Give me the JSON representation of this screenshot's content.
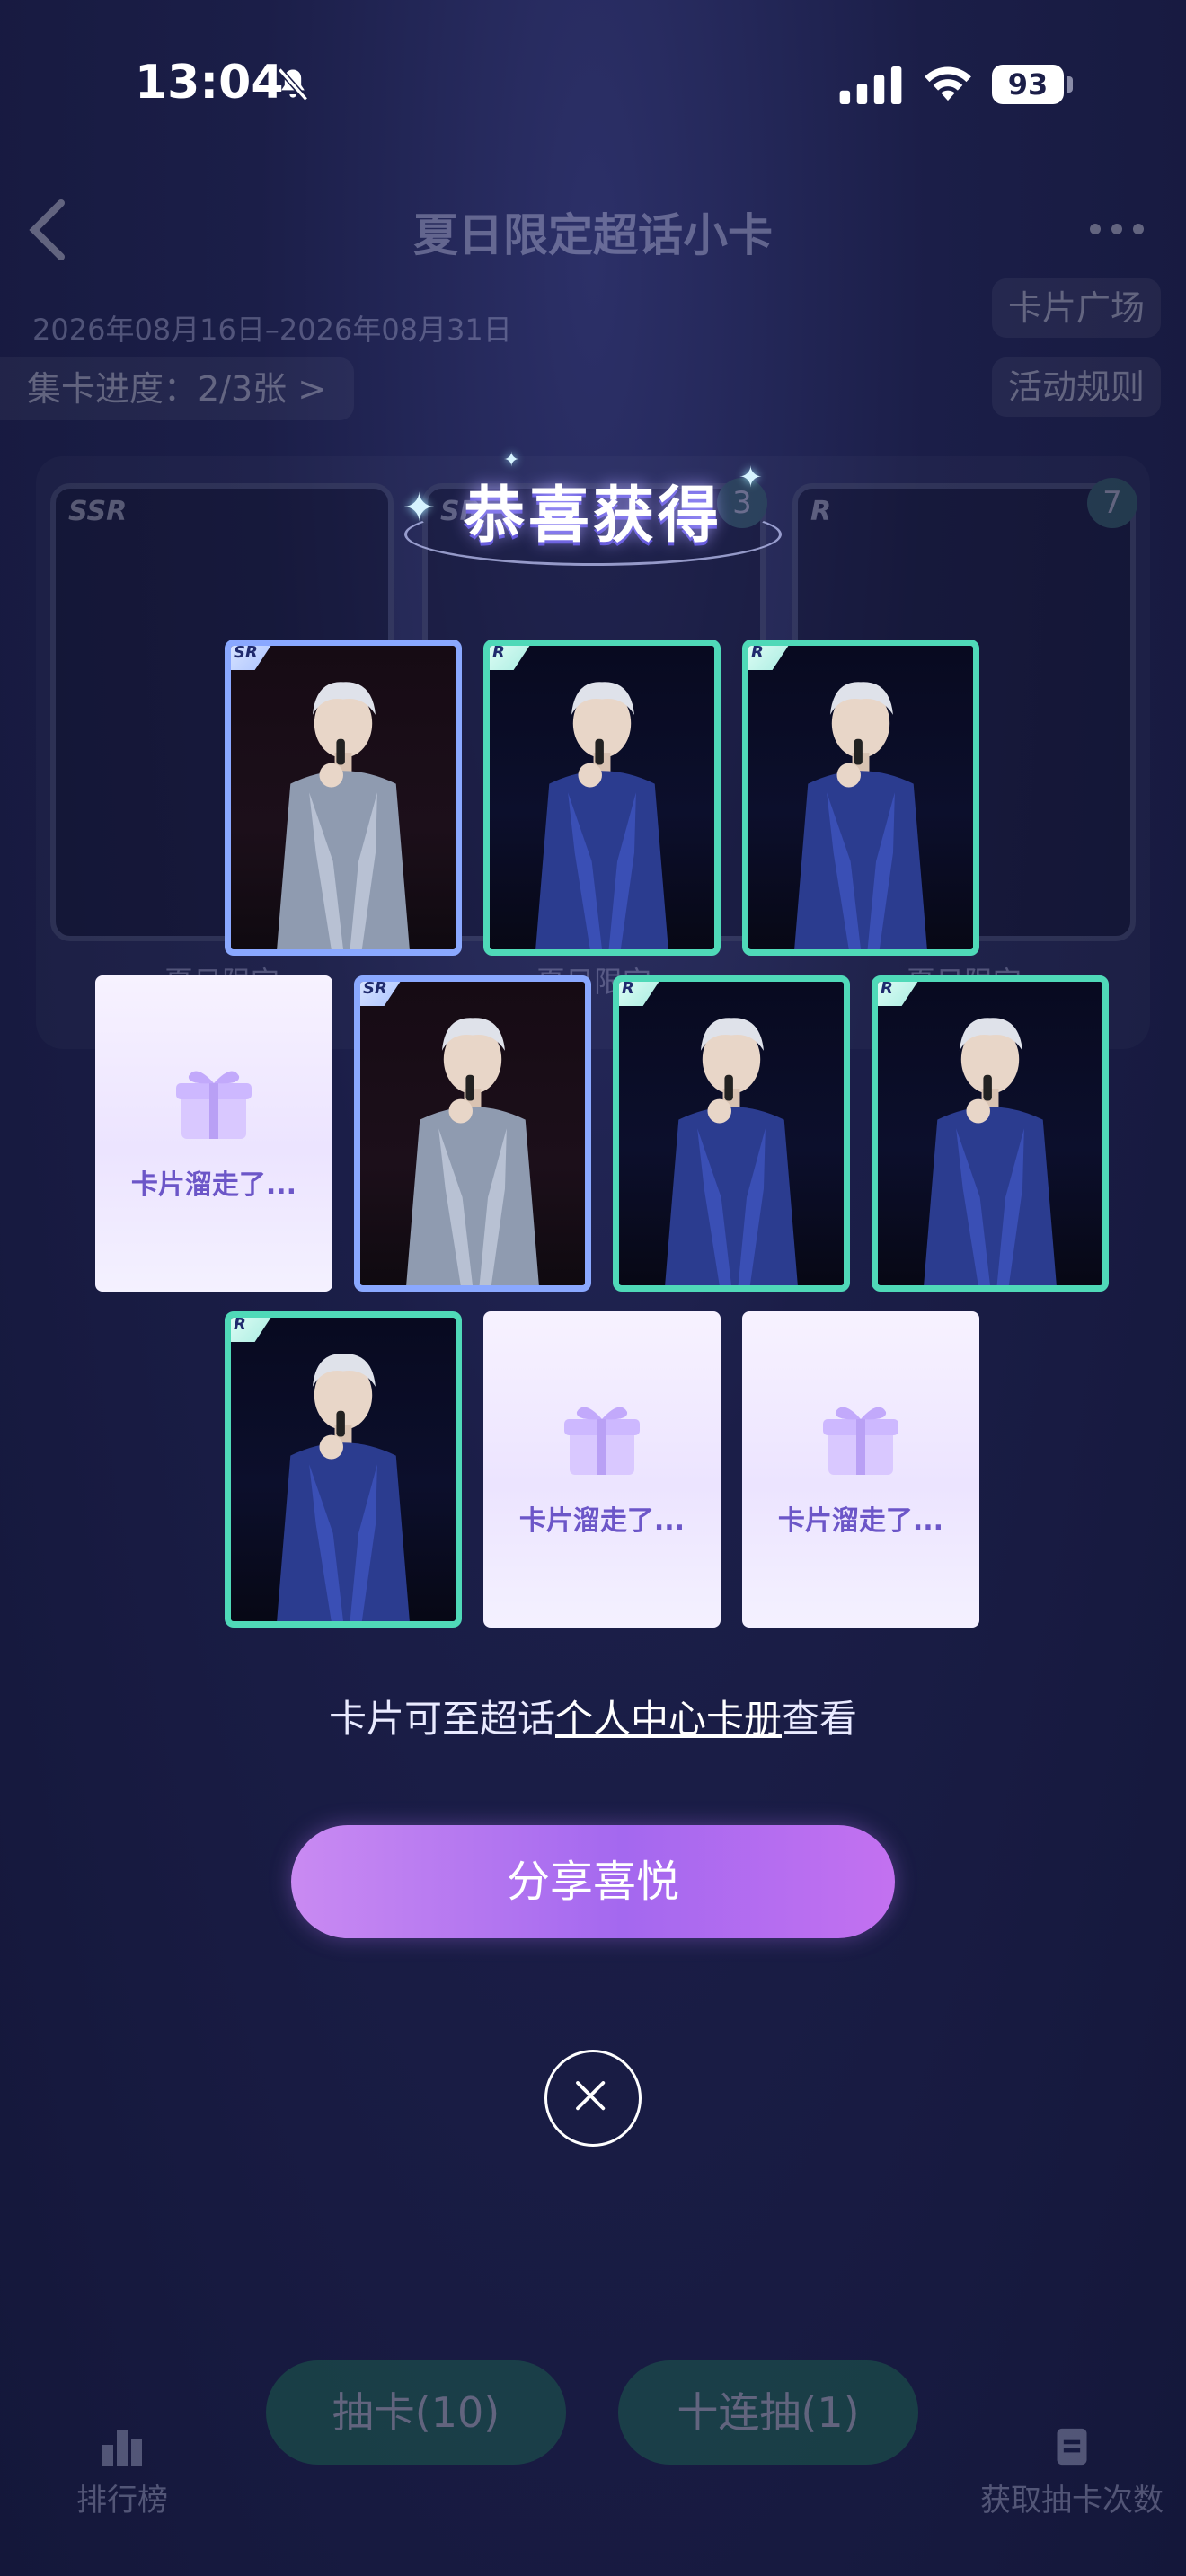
{
  "status_bar": {
    "time": "13:04",
    "battery": "93",
    "icons": [
      "bell-slash-icon",
      "cellular-signal-icon",
      "wifi-icon",
      "battery-icon"
    ]
  },
  "background_app": {
    "title": "夏日限定超话小卡",
    "date_range": "2026年08月16日–2026年08月31日",
    "card_plaza": "卡片广场",
    "activity_rules": "活动规则",
    "progress": "集卡进度：2/3张 >",
    "collection": [
      {
        "rarity": "SSR",
        "count": "",
        "label": "夏日限定"
      },
      {
        "rarity": "SR",
        "count": "3",
        "label": "夏日限定"
      },
      {
        "rarity": "R",
        "count": "7",
        "label": "夏日限定"
      }
    ],
    "nav": {
      "ranking": "排行榜",
      "draw_one": "抽卡(10)",
      "draw_ten": "十连抽(1)",
      "get_draws": "获取抽卡次数"
    }
  },
  "modal": {
    "title": "恭喜获得",
    "cards": [
      {
        "type": "card",
        "rarity": "SR"
      },
      {
        "type": "card",
        "rarity": "R"
      },
      {
        "type": "card",
        "rarity": "R"
      },
      {
        "type": "missed",
        "label": "卡片溜走了..."
      },
      {
        "type": "card",
        "rarity": "SR"
      },
      {
        "type": "card",
        "rarity": "R"
      },
      {
        "type": "card",
        "rarity": "R"
      },
      {
        "type": "card",
        "rarity": "R"
      },
      {
        "type": "missed",
        "label": "卡片溜走了..."
      },
      {
        "type": "missed",
        "label": "卡片溜走了..."
      }
    ],
    "hint_prefix": "卡片可至超话",
    "hint_link": "个人中心卡册",
    "hint_suffix": "查看",
    "share_button": "分享喜悦",
    "close_icon": "close-icon"
  },
  "colors": {
    "background": "#171a3d",
    "card_r_border": "#4fd9b8",
    "card_sr_border": "#8aa8ff",
    "share_button": "#b477f0",
    "nav_button": "#1f8a55"
  }
}
